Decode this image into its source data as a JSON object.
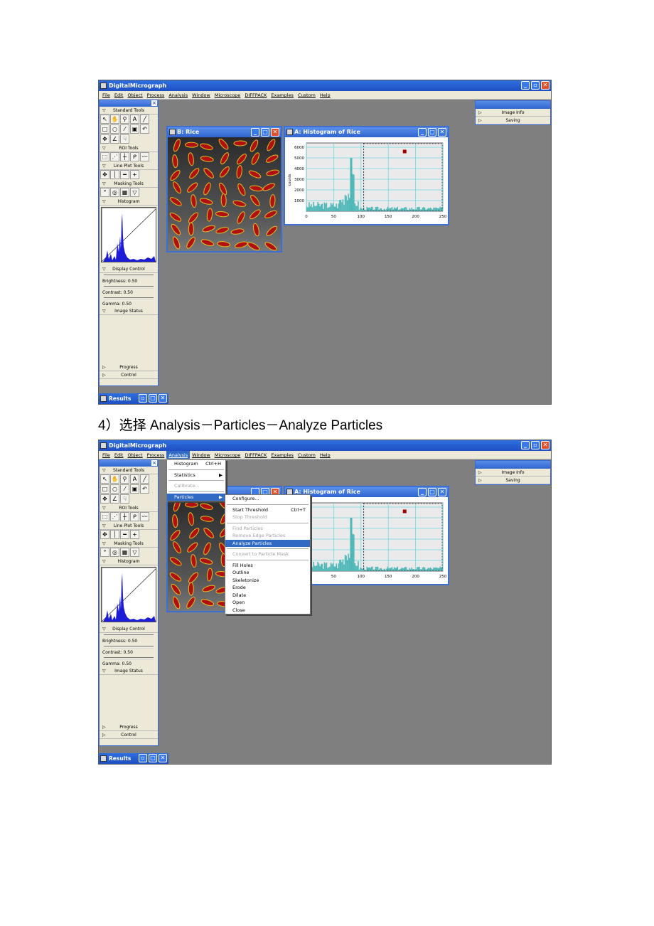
{
  "caption": "4）选择 Analysis－Particles－Analyze Particles",
  "app_title": "DigitalMicrograph",
  "menu": [
    "File",
    "Edit",
    "Object",
    "Process",
    "Analysis",
    "Window",
    "Microscope",
    "DIFFPACK",
    "Examples",
    "Custom",
    "Help"
  ],
  "tools": {
    "standard": "Standard Tools",
    "roi": "ROI Tools",
    "lineplot": "Line Plot Tools",
    "masking": "Masking Tools",
    "histogram": "Histogram",
    "display_control": "Display Control",
    "brightness": "Brightness: 0.50",
    "contrast": "Contrast: 0.50",
    "gamma": "Gamma: 0.50",
    "image_status": "Image Status",
    "progress": "Progress",
    "control": "Control"
  },
  "right_panel": {
    "image_info": "Image Info",
    "saving": "Saving"
  },
  "windows": {
    "rice": "B: Rice",
    "histogram": "A: Histogram of Rice",
    "results": "Results"
  },
  "histogram_plot": {
    "ylabel": "counts",
    "yticks": [
      "6000",
      "5000",
      "4000",
      "3000",
      "2000",
      "1000"
    ],
    "xticks": [
      "0",
      "50",
      "100",
      "150",
      "200",
      "250"
    ]
  },
  "analysis_menu": [
    {
      "label": "Histogram",
      "shortcut": "Ctrl+H"
    },
    {
      "label": "Statistics",
      "submenu": true
    },
    {
      "label": "Calibrate...",
      "disabled": true
    },
    {
      "label": "Particles",
      "submenu": true,
      "highlighted": true
    }
  ],
  "particles_menu": [
    {
      "label": "Configure..."
    },
    {
      "label": "Start Threshold",
      "shortcut": "Ctrl+T"
    },
    {
      "label": "Stop Threshold",
      "disabled": true
    },
    {
      "label": "Find Particles",
      "disabled": true
    },
    {
      "label": "Remove Edge Particles",
      "disabled": true
    },
    {
      "label": "Analyze Particles",
      "highlighted": true
    },
    {
      "label": "Convert to Particle Mask",
      "disabled": true
    },
    {
      "label": "Fill Holes"
    },
    {
      "label": "Outline"
    },
    {
      "label": "Skeletonize"
    },
    {
      "label": "Erode"
    },
    {
      "label": "Dilate"
    },
    {
      "label": "Open"
    },
    {
      "label": "Close"
    }
  ],
  "colors": {
    "titlebar": "#2e62cf",
    "highlight": "#316ac5",
    "desktop": "#7f7f7f",
    "hist_bars": "#4fb8b8"
  }
}
